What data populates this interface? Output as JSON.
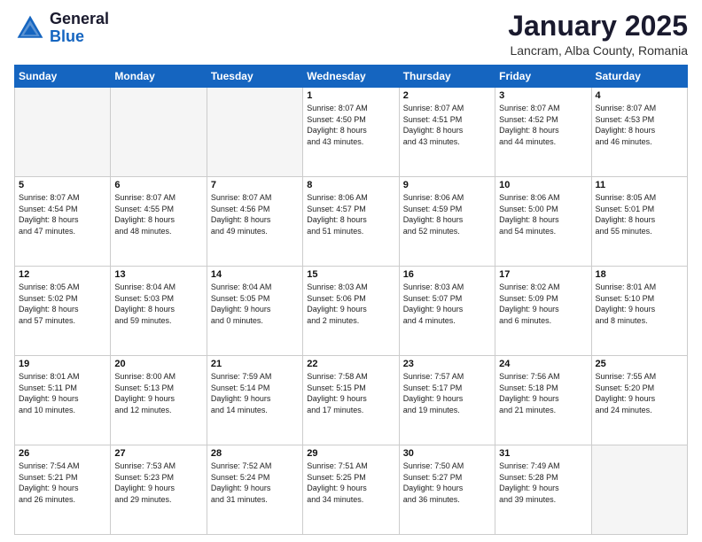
{
  "header": {
    "logo_general": "General",
    "logo_blue": "Blue",
    "month_year": "January 2025",
    "location": "Lancram, Alba County, Romania"
  },
  "weekdays": [
    "Sunday",
    "Monday",
    "Tuesday",
    "Wednesday",
    "Thursday",
    "Friday",
    "Saturday"
  ],
  "weeks": [
    [
      {
        "day": "",
        "info": ""
      },
      {
        "day": "",
        "info": ""
      },
      {
        "day": "",
        "info": ""
      },
      {
        "day": "1",
        "info": "Sunrise: 8:07 AM\nSunset: 4:50 PM\nDaylight: 8 hours\nand 43 minutes."
      },
      {
        "day": "2",
        "info": "Sunrise: 8:07 AM\nSunset: 4:51 PM\nDaylight: 8 hours\nand 43 minutes."
      },
      {
        "day": "3",
        "info": "Sunrise: 8:07 AM\nSunset: 4:52 PM\nDaylight: 8 hours\nand 44 minutes."
      },
      {
        "day": "4",
        "info": "Sunrise: 8:07 AM\nSunset: 4:53 PM\nDaylight: 8 hours\nand 46 minutes."
      }
    ],
    [
      {
        "day": "5",
        "info": "Sunrise: 8:07 AM\nSunset: 4:54 PM\nDaylight: 8 hours\nand 47 minutes."
      },
      {
        "day": "6",
        "info": "Sunrise: 8:07 AM\nSunset: 4:55 PM\nDaylight: 8 hours\nand 48 minutes."
      },
      {
        "day": "7",
        "info": "Sunrise: 8:07 AM\nSunset: 4:56 PM\nDaylight: 8 hours\nand 49 minutes."
      },
      {
        "day": "8",
        "info": "Sunrise: 8:06 AM\nSunset: 4:57 PM\nDaylight: 8 hours\nand 51 minutes."
      },
      {
        "day": "9",
        "info": "Sunrise: 8:06 AM\nSunset: 4:59 PM\nDaylight: 8 hours\nand 52 minutes."
      },
      {
        "day": "10",
        "info": "Sunrise: 8:06 AM\nSunset: 5:00 PM\nDaylight: 8 hours\nand 54 minutes."
      },
      {
        "day": "11",
        "info": "Sunrise: 8:05 AM\nSunset: 5:01 PM\nDaylight: 8 hours\nand 55 minutes."
      }
    ],
    [
      {
        "day": "12",
        "info": "Sunrise: 8:05 AM\nSunset: 5:02 PM\nDaylight: 8 hours\nand 57 minutes."
      },
      {
        "day": "13",
        "info": "Sunrise: 8:04 AM\nSunset: 5:03 PM\nDaylight: 8 hours\nand 59 minutes."
      },
      {
        "day": "14",
        "info": "Sunrise: 8:04 AM\nSunset: 5:05 PM\nDaylight: 9 hours\nand 0 minutes."
      },
      {
        "day": "15",
        "info": "Sunrise: 8:03 AM\nSunset: 5:06 PM\nDaylight: 9 hours\nand 2 minutes."
      },
      {
        "day": "16",
        "info": "Sunrise: 8:03 AM\nSunset: 5:07 PM\nDaylight: 9 hours\nand 4 minutes."
      },
      {
        "day": "17",
        "info": "Sunrise: 8:02 AM\nSunset: 5:09 PM\nDaylight: 9 hours\nand 6 minutes."
      },
      {
        "day": "18",
        "info": "Sunrise: 8:01 AM\nSunset: 5:10 PM\nDaylight: 9 hours\nand 8 minutes."
      }
    ],
    [
      {
        "day": "19",
        "info": "Sunrise: 8:01 AM\nSunset: 5:11 PM\nDaylight: 9 hours\nand 10 minutes."
      },
      {
        "day": "20",
        "info": "Sunrise: 8:00 AM\nSunset: 5:13 PM\nDaylight: 9 hours\nand 12 minutes."
      },
      {
        "day": "21",
        "info": "Sunrise: 7:59 AM\nSunset: 5:14 PM\nDaylight: 9 hours\nand 14 minutes."
      },
      {
        "day": "22",
        "info": "Sunrise: 7:58 AM\nSunset: 5:15 PM\nDaylight: 9 hours\nand 17 minutes."
      },
      {
        "day": "23",
        "info": "Sunrise: 7:57 AM\nSunset: 5:17 PM\nDaylight: 9 hours\nand 19 minutes."
      },
      {
        "day": "24",
        "info": "Sunrise: 7:56 AM\nSunset: 5:18 PM\nDaylight: 9 hours\nand 21 minutes."
      },
      {
        "day": "25",
        "info": "Sunrise: 7:55 AM\nSunset: 5:20 PM\nDaylight: 9 hours\nand 24 minutes."
      }
    ],
    [
      {
        "day": "26",
        "info": "Sunrise: 7:54 AM\nSunset: 5:21 PM\nDaylight: 9 hours\nand 26 minutes."
      },
      {
        "day": "27",
        "info": "Sunrise: 7:53 AM\nSunset: 5:23 PM\nDaylight: 9 hours\nand 29 minutes."
      },
      {
        "day": "28",
        "info": "Sunrise: 7:52 AM\nSunset: 5:24 PM\nDaylight: 9 hours\nand 31 minutes."
      },
      {
        "day": "29",
        "info": "Sunrise: 7:51 AM\nSunset: 5:25 PM\nDaylight: 9 hours\nand 34 minutes."
      },
      {
        "day": "30",
        "info": "Sunrise: 7:50 AM\nSunset: 5:27 PM\nDaylight: 9 hours\nand 36 minutes."
      },
      {
        "day": "31",
        "info": "Sunrise: 7:49 AM\nSunset: 5:28 PM\nDaylight: 9 hours\nand 39 minutes."
      },
      {
        "day": "",
        "info": ""
      }
    ]
  ]
}
